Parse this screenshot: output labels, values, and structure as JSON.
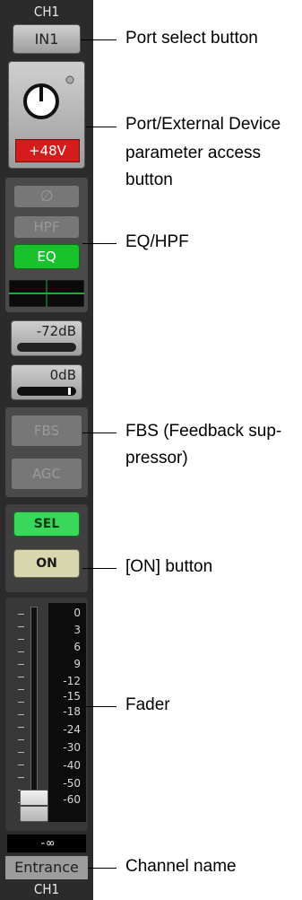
{
  "channel": {
    "top_label": "CH1",
    "port_button": "IN1",
    "phantom_label": "+48V",
    "phase_label": "∅",
    "hpf_label": "HPF",
    "eq_label": "EQ",
    "gain_label": "-72dB",
    "level_label": "0dB",
    "fbs_label": "FBS",
    "agc_label": "AGC",
    "sel_label": "SEL",
    "on_label": "ON",
    "fader_scale": [
      "0",
      "3",
      "6",
      "9",
      "-12",
      "-15",
      "-18",
      "-24",
      "-30",
      "-40",
      "-50",
      "-60"
    ],
    "fader_value": "-∞",
    "channel_name": "Entrance",
    "bottom_label": "CH1"
  },
  "callouts": {
    "port_select": "Port select button",
    "port_ext_line1": "Port/External Device",
    "port_ext_line2": "parameter access",
    "port_ext_line3": "button",
    "eq_hpf": "EQ/HPF",
    "fbs_line1": "FBS (Feedback sup-",
    "fbs_line2": "pressor)",
    "on_button": "[ON] button",
    "fader": "Fader",
    "channel_name": "Channel name"
  },
  "colors": {
    "strip_bg": "#2b2b2b",
    "phantom_red": "#d41c1c",
    "eq_green": "#17c22b",
    "sel_green": "#39d85a",
    "on_beige": "#d9d7b0"
  }
}
